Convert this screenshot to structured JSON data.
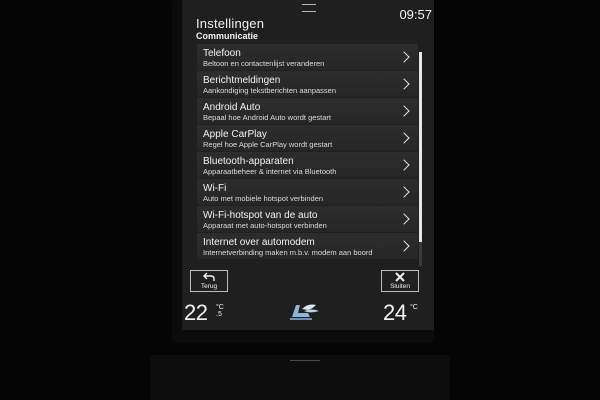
{
  "header": {
    "title": "Instellingen",
    "subtitle": "Communicatie",
    "clock": "09:57"
  },
  "menu": {
    "items": [
      {
        "title": "Telefoon",
        "subtitle": "Beltoon en contactenlijst veranderen"
      },
      {
        "title": "Berichtmeldingen",
        "subtitle": "Aankondiging tekstberichten aanpassen"
      },
      {
        "title": "Android Auto",
        "subtitle": "Bepaal hoe Android Auto wordt gestart"
      },
      {
        "title": "Apple CarPlay",
        "subtitle": "Regel hoe Apple CarPlay wordt gestart"
      },
      {
        "title": "Bluetooth-apparaten",
        "subtitle": "Apparaatbeheer & internet via Bluetooth"
      },
      {
        "title": "Wi-Fi",
        "subtitle": "Auto met mobiele hotspot verbinden"
      },
      {
        "title": "Wi-Fi-hotspot van de auto",
        "subtitle": "Apparaat met auto-hotspot verbinden"
      },
      {
        "title": "Internet over automodem",
        "subtitle": "Internetverbinding maken m.b.v. modem aan boord"
      }
    ]
  },
  "footer": {
    "back_label": "Terug",
    "close_label": "Sluiten"
  },
  "climate": {
    "left_temp": "22",
    "left_unit": "°C",
    "left_decimal": ".5",
    "right_temp": "24",
    "right_unit": "°C"
  },
  "icons": {
    "back": "back-arrow-icon",
    "close": "close-x-icon",
    "chevron": "chevron-right-icon",
    "fan": "seat-fan-icon"
  },
  "colors": {
    "accent": "#ffffff",
    "background": "#1f1f1f",
    "row": "#2b2b2b"
  }
}
